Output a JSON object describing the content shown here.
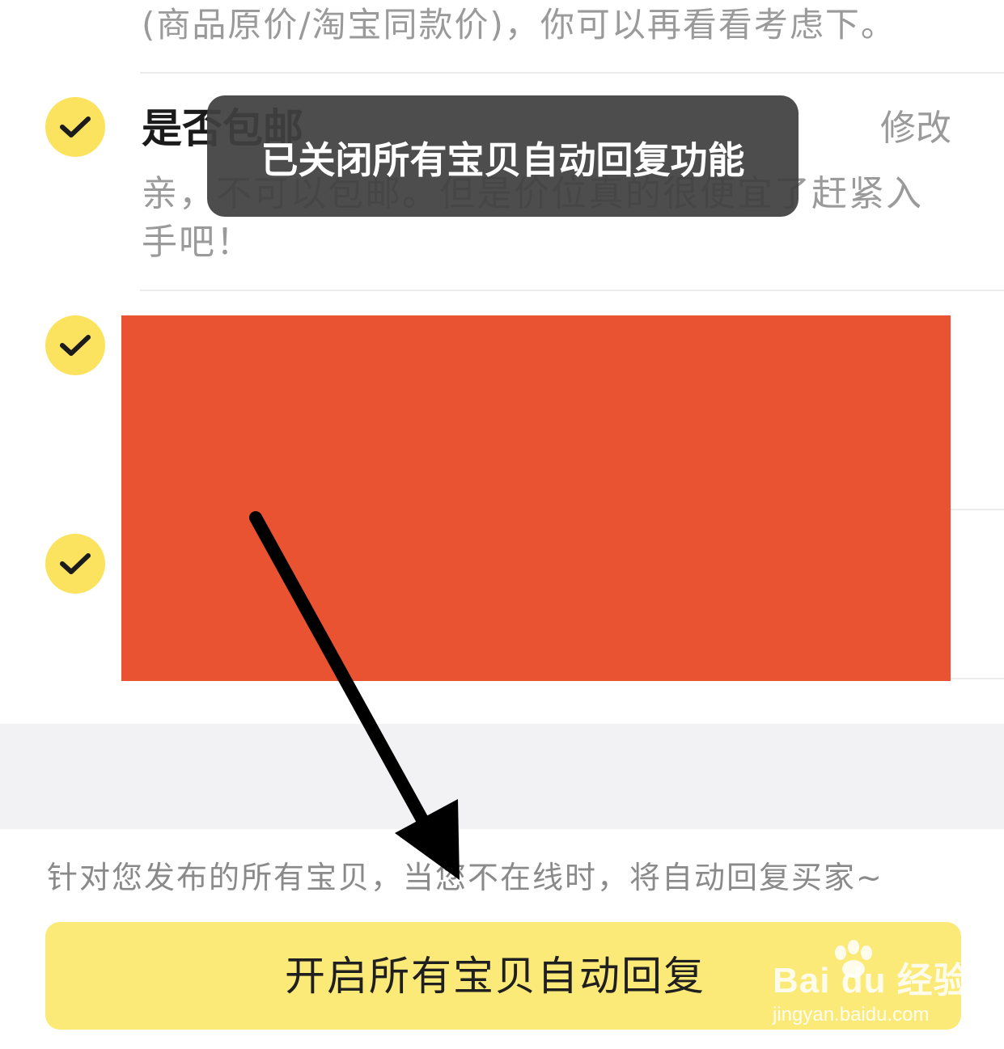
{
  "list": {
    "prev_item_desc_tail": "(商品原价/淘宝同款价)，你可以再看看考虑下。",
    "items": [
      {
        "title": "是否包邮",
        "edit_label": "修改",
        "desc": "亲，不可以包邮。但是价位真的很便宜了赶紧入手吧！",
        "checked": true
      },
      {
        "checked": true
      },
      {
        "checked": true
      }
    ]
  },
  "toast": {
    "message": "已关闭所有宝贝自动回复功能"
  },
  "footer": {
    "note": "针对您发布的所有宝贝，当您不在线时，将自动回复买家~",
    "enable_button_label": "开启所有宝贝自动回复"
  },
  "watermark": {
    "logo": "Bai du 经验",
    "url": "jingyan.baidu.com"
  },
  "icons": {
    "check": "check-icon",
    "arrow": "arrow-annotation"
  },
  "colors": {
    "accent_yellow": "#fbe35f",
    "button_yellow": "#fbe978",
    "redaction": "#e95331",
    "toast_bg": "#404040"
  }
}
